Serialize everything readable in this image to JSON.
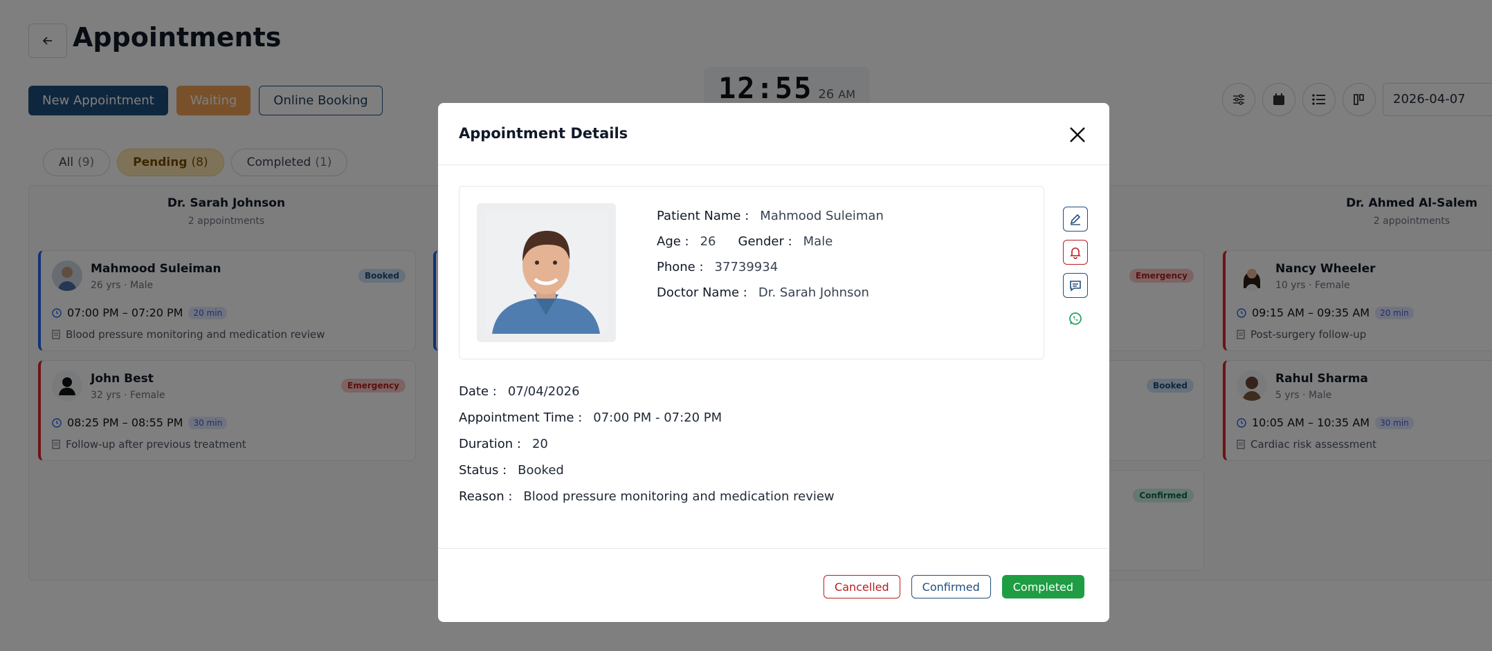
{
  "header": {
    "title": "Appointments",
    "buttons": {
      "new": "New Appointment",
      "waiting": "Waiting",
      "online": "Online Booking"
    },
    "clock": {
      "time": "12:55",
      "seconds": "26",
      "ampm": "AM"
    },
    "date_value": "2026-04-07"
  },
  "filters": [
    {
      "label": "All",
      "count": "(9)"
    },
    {
      "label": "Pending",
      "count": "(8)"
    },
    {
      "label": "Completed",
      "count": "(1)"
    }
  ],
  "columns": [
    {
      "doctor": "Dr. Sarah Johnson",
      "sub": "2 appointments"
    },
    {
      "doctor": "Dr. Ahmed Al-Salem",
      "sub": "2 appointments"
    }
  ],
  "cards": {
    "c1": {
      "name": "Mahmood Suleiman",
      "meta": "26 yrs · Male",
      "badge": "Booked",
      "time": "07:00 PM – 07:20 PM",
      "dur": "20 min",
      "reason": "Blood pressure monitoring and medication review"
    },
    "c2": {
      "name": "John Best",
      "meta": "32 yrs · Female",
      "badge": "Emergency",
      "time": "08:25 PM – 08:55 PM",
      "dur": "30 min",
      "reason": "Follow-up after previous treatment"
    },
    "c3": {
      "name": "Nancy Wheeler",
      "meta": "10 yrs · Female",
      "time": "09:15 AM – 09:35 AM",
      "dur": "20 min",
      "reason": "Post-surgery follow-up"
    },
    "c4": {
      "name": "Rahul Sharma",
      "meta": "5 yrs · Male",
      "time": "10:05 AM – 10:35 AM",
      "dur": "30 min",
      "reason": "Cardiac risk assessment"
    },
    "m1": {
      "badge": "Emergency"
    },
    "m2": {
      "badge": "Booked"
    },
    "m3": {
      "badge": "Confirmed"
    }
  },
  "modal": {
    "title": "Appointment Details",
    "labels": {
      "patient_name": "Patient Name :",
      "age": "Age :",
      "gender": "Gender :",
      "phone": "Phone :",
      "doctor": "Doctor Name :",
      "date": "Date :",
      "time": "Appointment Time :",
      "duration": "Duration :",
      "status": "Status :",
      "reason": "Reason :"
    },
    "values": {
      "patient_name": "Mahmood Suleiman",
      "age": "26",
      "gender": "Male",
      "phone": "37739934",
      "doctor": "Dr. Sarah Johnson",
      "date": "07/04/2026",
      "time": "07:00 PM - 07:20 PM",
      "duration": "20",
      "status": "Booked",
      "reason": "Blood pressure monitoring and medication review"
    },
    "buttons": {
      "cancelled": "Cancelled",
      "confirmed": "Confirmed",
      "completed": "Completed"
    }
  },
  "colors": {
    "primary": "#1e4e7c",
    "waiting": "#f0a255",
    "completed": "#1f9d43",
    "cancelled": "#b91c1c",
    "whatsapp": "#25a55f"
  }
}
